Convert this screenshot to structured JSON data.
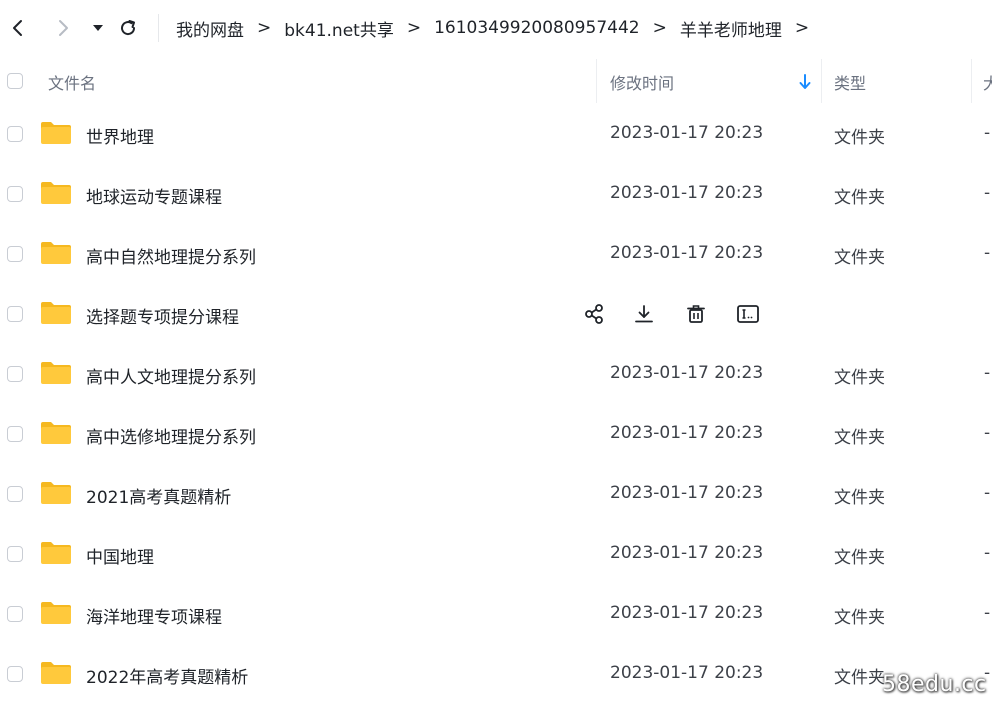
{
  "nav": {
    "back_icon": "chevron-left-icon",
    "forward_icon": "chevron-right-icon",
    "dropdown_icon": "caret-down-icon",
    "refresh_icon": "refresh-icon"
  },
  "breadcrumb": {
    "items": [
      "我的网盘",
      "bk41.net共享",
      "1610349920080957442",
      "羊羊老师地理"
    ],
    "separator": ">"
  },
  "columns": {
    "name": "文件名",
    "modified": "修改时间",
    "type": "类型",
    "size": "大"
  },
  "colors": {
    "folder": "#FFC93C",
    "folder_back": "#F5B820",
    "sort_arrow": "#1a8cff"
  },
  "files": [
    {
      "name": "世界地理",
      "date": "2023-01-17 20:23",
      "type": "文件夹",
      "size": "-"
    },
    {
      "name": "地球运动专题课程",
      "date": "2023-01-17 20:23",
      "type": "文件夹",
      "size": "-"
    },
    {
      "name": "高中自然地理提分系列",
      "date": "2023-01-17 20:23",
      "type": "文件夹",
      "size": "-"
    },
    {
      "name": "选择题专项提分课程",
      "hovered": true,
      "actions": [
        "share-icon",
        "download-icon",
        "delete-icon",
        "rename-icon"
      ]
    },
    {
      "name": "高中人文地理提分系列",
      "date": "2023-01-17 20:23",
      "type": "文件夹",
      "size": "-"
    },
    {
      "name": "高中选修地理提分系列",
      "date": "2023-01-17 20:23",
      "type": "文件夹",
      "size": "-"
    },
    {
      "name": "2021高考真题精析",
      "date": "2023-01-17 20:23",
      "type": "文件夹",
      "size": "-"
    },
    {
      "name": "中国地理",
      "date": "2023-01-17 20:23",
      "type": "文件夹",
      "size": "-"
    },
    {
      "name": "海洋地理专项课程",
      "date": "2023-01-17 20:23",
      "type": "文件夹",
      "size": "-"
    },
    {
      "name": "2022年高考真题精析",
      "date": "2023-01-17 20:23",
      "type": "文件夹",
      "size": "-"
    }
  ],
  "watermark": "58edu.cc"
}
